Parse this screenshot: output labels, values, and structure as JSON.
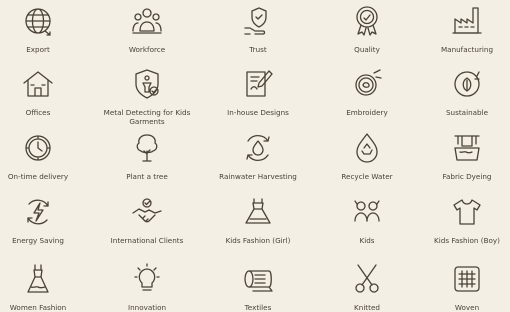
{
  "items": [
    {
      "label": "Export",
      "icon": "globe-arrows-icon"
    },
    {
      "label": "Workforce",
      "icon": "workforce-icon"
    },
    {
      "label": "Trust",
      "icon": "trust-hand-shield-icon"
    },
    {
      "label": "Quality",
      "icon": "quality-badge-icon"
    },
    {
      "label": "Manufacturing",
      "icon": "factory-icon"
    },
    {
      "label": "Offices",
      "icon": "office-building-icon"
    },
    {
      "label": "Metal Detecting for Kids Garments",
      "icon": "metal-detector-shield-icon"
    },
    {
      "label": "In-house Designs",
      "icon": "design-pencil-icon"
    },
    {
      "label": "Embroidery",
      "icon": "embroidery-hoop-icon"
    },
    {
      "label": "Sustainable",
      "icon": "leaf-cycle-icon"
    },
    {
      "label": "On-time delivery",
      "icon": "clock-icon"
    },
    {
      "label": "Plant a tree",
      "icon": "tree-icon"
    },
    {
      "label": "Rainwater Harvesting",
      "icon": "water-drop-cycle-icon"
    },
    {
      "label": "Recycle Water",
      "icon": "recycle-drop-icon"
    },
    {
      "label": "Fabric Dyeing",
      "icon": "dyeing-vat-icon"
    },
    {
      "label": "Energy Saving",
      "icon": "lightning-cycle-icon"
    },
    {
      "label": "International Clients",
      "icon": "handshake-icon"
    },
    {
      "label": "Kids Fashion (Girl)",
      "icon": "girl-dress-icon"
    },
    {
      "label": "Kids",
      "icon": "kids-icon"
    },
    {
      "label": "Kids Fashion (Boy)",
      "icon": "boy-tshirt-icon"
    },
    {
      "label": "Women Fashion",
      "icon": "women-dress-icon"
    },
    {
      "label": "Innovation",
      "icon": "lightbulb-icon"
    },
    {
      "label": "Textiles",
      "icon": "fabric-roll-icon"
    },
    {
      "label": "Knitted",
      "icon": "scissors-icon"
    },
    {
      "label": "Woven",
      "icon": "woven-grid-icon"
    }
  ]
}
